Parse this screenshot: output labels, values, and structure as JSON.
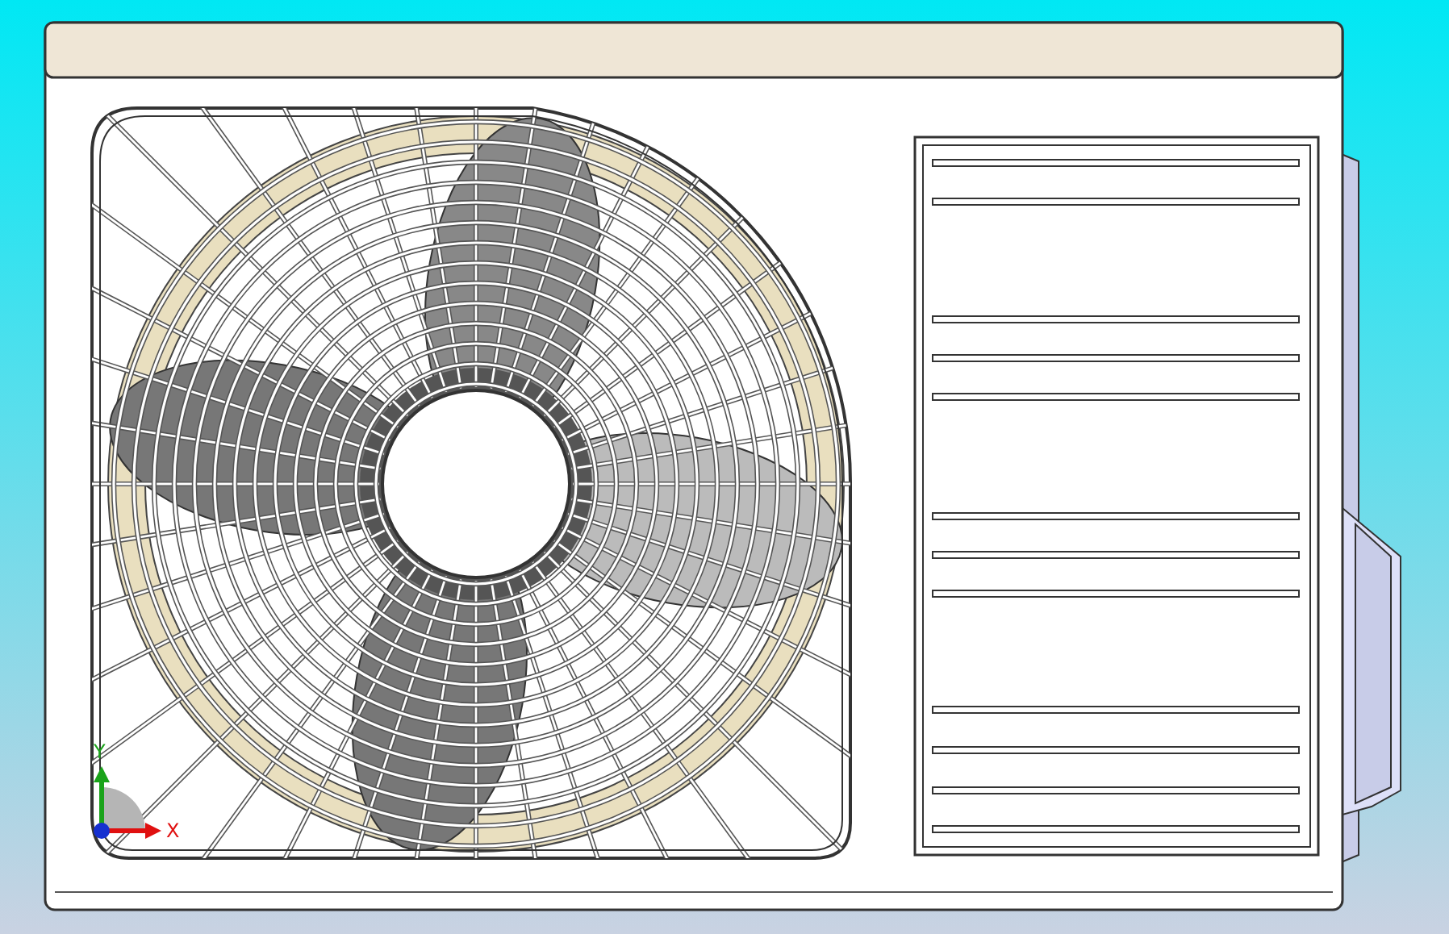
{
  "axis_triad": {
    "y_label": "Y",
    "x_label": "X"
  }
}
